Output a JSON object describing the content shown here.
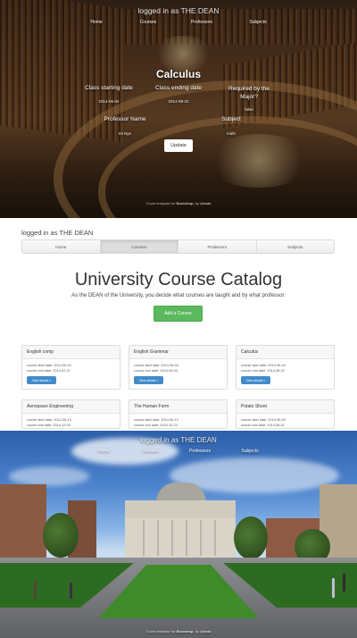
{
  "course_edit": {
    "logged_in": "logged in as THE DEAN",
    "nav": [
      "Home",
      "Courses",
      "Professors",
      "Subjects"
    ],
    "course_title": "Calculus",
    "fields": [
      {
        "label": "Class starting date",
        "value": "2014-06-04"
      },
      {
        "label": "Class ending date",
        "value": "2014-08-22"
      },
      {
        "label": "Required by the Major?",
        "value": "false"
      },
      {
        "label": "Professor Name",
        "value": "Mi Nye"
      },
      {
        "label": "Subject",
        "value": "math"
      }
    ],
    "update_label": "Update",
    "footer": {
      "prefix": "Cover template for ",
      "bootstrap": "Bootstrap",
      "middle": ", by ",
      "author": "@mdo"
    }
  },
  "catalog": {
    "logged_in": "logged in as THE DEAN",
    "tabs": [
      "Home",
      "Courses",
      "Professors",
      "Subjects"
    ],
    "active_tab": "Courses",
    "title": "University Course Catalog",
    "lead": "As the DEAN of the University, you decide what courses are taught and by what professor.",
    "add_label": "Add a Course",
    "start_label": "course start date:",
    "end_label": "course end date:",
    "details_label": "View details »",
    "courses": [
      {
        "name": "English comp",
        "start": "2014-06-03",
        "end": "2014-07-21"
      },
      {
        "name": "English Grammar",
        "start": "2014-06-04",
        "end": "2014-09-03"
      },
      {
        "name": "Calculus",
        "start": "2014-06-04",
        "end": "2014-08-22"
      },
      {
        "name": "Aerospace Engineering",
        "start": "2014-06-13",
        "end": "2014-12-03"
      },
      {
        "name": "The Human Form",
        "start": "2014-06-12",
        "end": "2014-12-23"
      },
      {
        "name": "Potato Shoot",
        "start": "2014-06-20",
        "end": "2014-08-01"
      }
    ]
  },
  "campus": {
    "logged_in": "logged in as THE DEAN",
    "nav": [
      "Home",
      "Courses",
      "Professors",
      "Subjects"
    ],
    "footer": {
      "prefix": "Cover template for ",
      "bootstrap": "Bootstrap",
      "middle": ", by ",
      "author": "@mdo"
    }
  },
  "colors": {
    "success": "#5cb85c",
    "primary": "#428bca"
  }
}
